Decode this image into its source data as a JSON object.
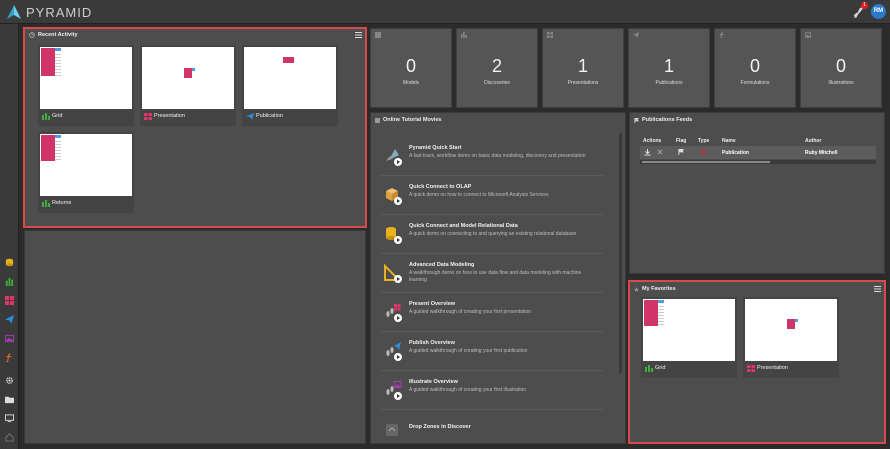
{
  "app": {
    "name": "PYRAMID",
    "user_initials": "RM",
    "notification_count": "1"
  },
  "recent_activity": {
    "title": "Recent Activity",
    "items": [
      {
        "label": "Grid",
        "type": "grid"
      },
      {
        "label": "Presentation",
        "type": "presentation"
      },
      {
        "label": "Publication",
        "type": "publication"
      },
      {
        "label": "Returns",
        "type": "grid"
      }
    ]
  },
  "stats": [
    {
      "value": "0",
      "label": "Models"
    },
    {
      "value": "2",
      "label": "Discoveries"
    },
    {
      "value": "1",
      "label": "Presentations"
    },
    {
      "value": "1",
      "label": "Publications"
    },
    {
      "value": "0",
      "label": "Formulations"
    },
    {
      "value": "0",
      "label": "Illustrations"
    }
  ],
  "tutorials": {
    "title": "Online Tutorial Movies",
    "items": [
      {
        "title": "Pyramid Quick Start",
        "desc": "A fast-track, workflow demo on basic data modeling, discovery and presentation"
      },
      {
        "title": "Quick Connect to OLAP",
        "desc": "A quick demo on how to connect to Microsoft Analysis Services"
      },
      {
        "title": "Quick Connect and Model Relational Data",
        "desc": "A quick demo on connecting to and querying an existing relational database"
      },
      {
        "title": "Advanced Data Modeling",
        "desc": "A walkthrough demo on how to use data flow and data modeling with machine learning"
      },
      {
        "title": "Present Overview",
        "desc": "A guided walkthrough of creating your first presentation"
      },
      {
        "title": "Publish Overview",
        "desc": "A guided walkthrough of creating your first publication"
      },
      {
        "title": "Illustrate Overview",
        "desc": "A guided walkthrough of creating your first illustration"
      },
      {
        "title": "Drop Zones in Discover",
        "desc": ""
      }
    ]
  },
  "feeds": {
    "title": "Publications Feeds",
    "columns": [
      "Actions",
      "Flag",
      "Type",
      "Name",
      "Author"
    ],
    "rows": [
      {
        "name": "Publication",
        "author": "Ruby Mitchell"
      }
    ]
  },
  "favorites": {
    "title": "My Favorites",
    "items": [
      {
        "label": "Grid",
        "type": "grid"
      },
      {
        "label": "Presentation",
        "type": "presentation"
      }
    ]
  },
  "colors": {
    "accent_red": "#d84a4a",
    "grid_green": "#3fae3a",
    "present_pink": "#e0356a",
    "publish_blue": "#2a8ee0",
    "illustrate_purple": "#a83ab8",
    "model_yellow": "#e8b21f"
  }
}
